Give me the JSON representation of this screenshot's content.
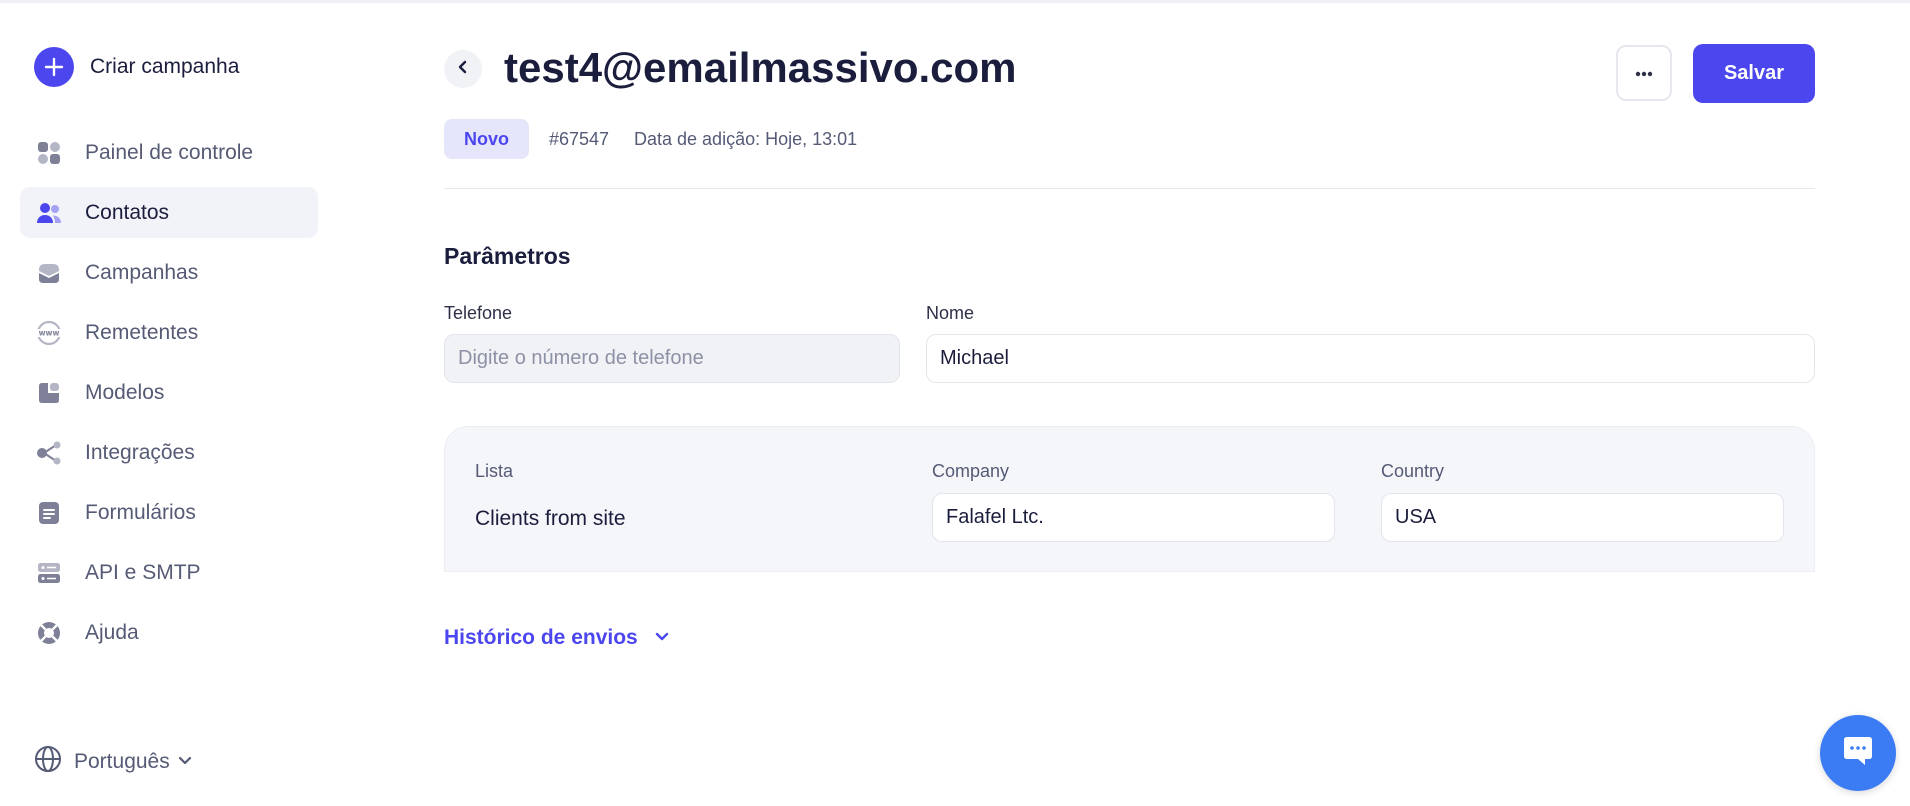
{
  "sidebar": {
    "create_label": "Criar campanha",
    "items": [
      {
        "label": "Painel de controle",
        "icon": "dashboard-icon"
      },
      {
        "label": "Contatos",
        "icon": "contacts-icon",
        "active": true
      },
      {
        "label": "Campanhas",
        "icon": "campaigns-icon"
      },
      {
        "label": "Remetentes",
        "icon": "senders-www-icon"
      },
      {
        "label": "Modelos",
        "icon": "templates-icon"
      },
      {
        "label": "Integrações",
        "icon": "integrations-icon"
      },
      {
        "label": "Formulários",
        "icon": "forms-icon"
      },
      {
        "label": "API e SMTP",
        "icon": "api-smtp-icon"
      },
      {
        "label": "Ajuda",
        "icon": "help-lifebuoy-icon"
      }
    ],
    "language": "Português"
  },
  "header": {
    "title": "test4@emailmassivo.com",
    "save_label": "Salvar",
    "status": "Novo",
    "contact_id": "#67547",
    "added_date": "Data de adição: Hoje, 13:01"
  },
  "params": {
    "section_title": "Parâmetros",
    "phone_label": "Telefone",
    "phone_value": "",
    "phone_placeholder": "Digite o número de telefone",
    "name_label": "Nome",
    "name_value": "Michael"
  },
  "custom_fields": {
    "list_label": "Lista",
    "list_value": "Clients from site",
    "company_label": "Company",
    "company_value": "Falafel Ltc.",
    "country_label": "Country",
    "country_value": "USA"
  },
  "history": {
    "label": "Histórico de envios"
  },
  "colors": {
    "accent": "#4b46ee",
    "active_nav_bg": "#f1f3f8",
    "badge_bg": "#e5e6fb",
    "chat_button": "#3b7cf5"
  }
}
